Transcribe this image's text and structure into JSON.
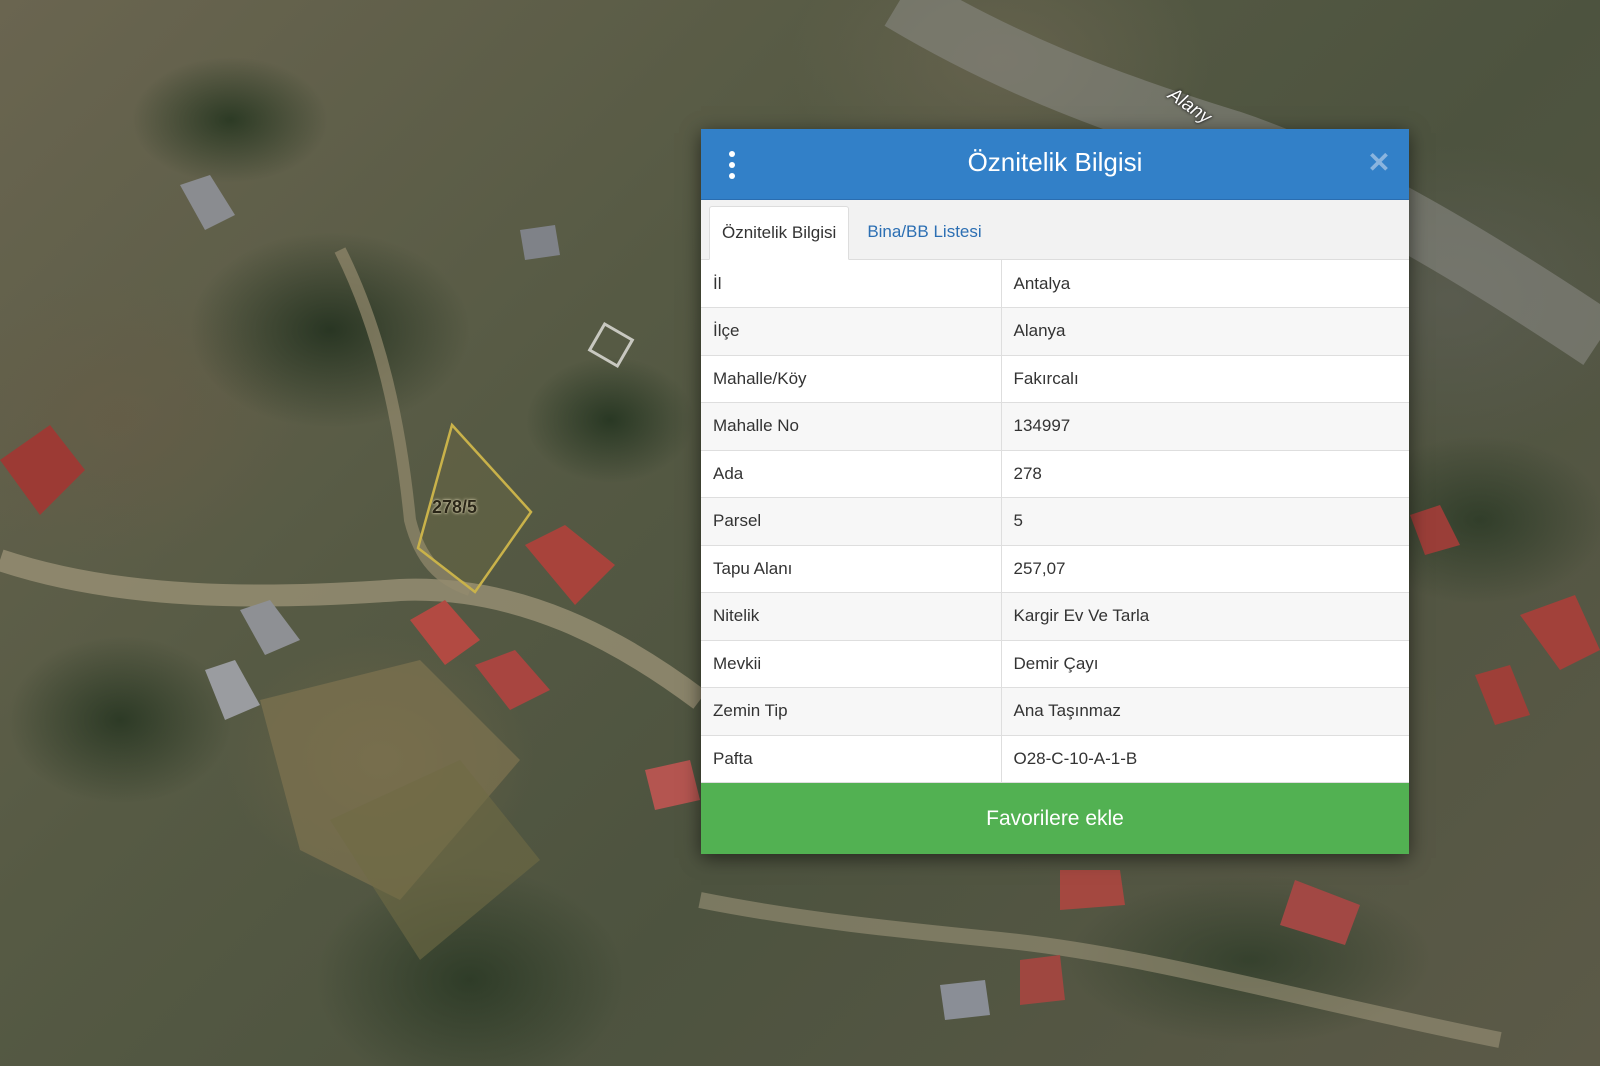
{
  "map": {
    "parcel_label": "278/5",
    "road_label": "Alany"
  },
  "dialog": {
    "title": "Öznitelik Bilgisi",
    "menu_icon": "vertical-ellipsis-icon",
    "close_icon": "close-icon",
    "tabs": [
      {
        "label": "Öznitelik Bilgisi",
        "active": true
      },
      {
        "label": "Bina/BB Listesi",
        "active": false
      }
    ],
    "rows": [
      {
        "key": "İl",
        "value": "Antalya"
      },
      {
        "key": "İlçe",
        "value": "Alanya"
      },
      {
        "key": "Mahalle/Köy",
        "value": "Fakırcalı"
      },
      {
        "key": "Mahalle No",
        "value": "134997"
      },
      {
        "key": "Ada",
        "value": "278"
      },
      {
        "key": "Parsel",
        "value": "5"
      },
      {
        "key": "Tapu Alanı",
        "value": "257,07"
      },
      {
        "key": "Nitelik",
        "value": "Kargir Ev Ve Tarla"
      },
      {
        "key": "Mevkii",
        "value": "Demir Çayı"
      },
      {
        "key": "Zemin Tip",
        "value": "Ana Taşınmaz"
      },
      {
        "key": "Pafta",
        "value": "O28-C-10-A-1-B"
      }
    ],
    "favorite_button": "Favorilere ekle"
  },
  "colors": {
    "header": "#3280c8",
    "tab_link": "#2c6fb3",
    "favorite_button": "#52b152",
    "parcel_outline": "#c9b24a"
  }
}
